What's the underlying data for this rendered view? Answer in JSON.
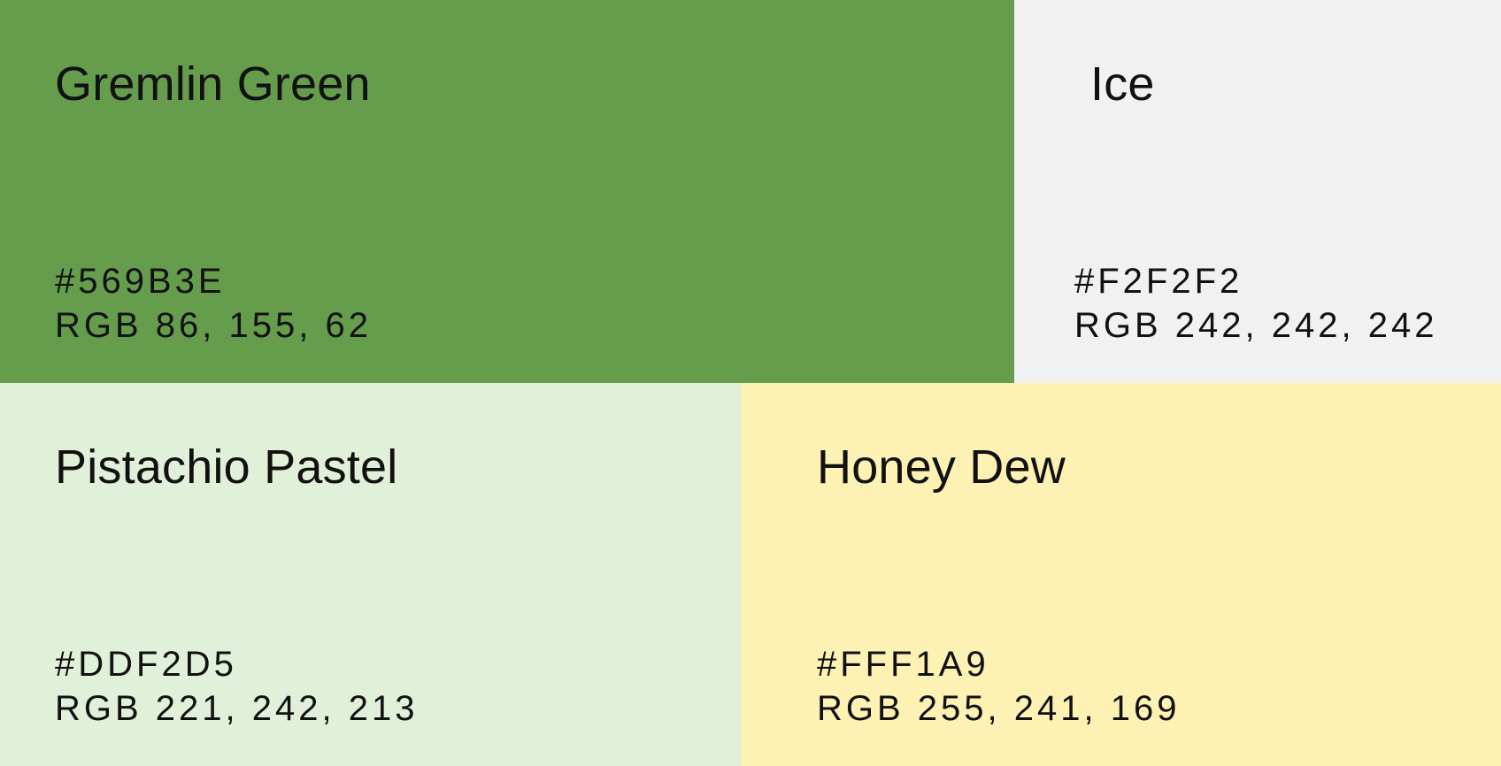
{
  "swatches": [
    {
      "name": "Gremlin Green",
      "hex": "#569B3E",
      "rgb": "RGB 86, 155, 62",
      "color": "#569B3E",
      "display_color": "#669D4C"
    },
    {
      "name": "Ice",
      "hex": "#F2F2F2",
      "rgb": "RGB 242, 242, 242",
      "color": "#F2F2F2",
      "display_color": "#F1F1F1"
    },
    {
      "name": "Pistachio Pastel",
      "hex": "#DDF2D5",
      "rgb": "RGB 221, 242, 213",
      "color": "#DDF2D5",
      "display_color": "#E1F0D8"
    },
    {
      "name": "Honey Dew",
      "hex": "#FFF1A9",
      "rgb": "RGB 255, 241, 169",
      "color": "#FFF1A9",
      "display_color": "#FDF1B3"
    }
  ]
}
